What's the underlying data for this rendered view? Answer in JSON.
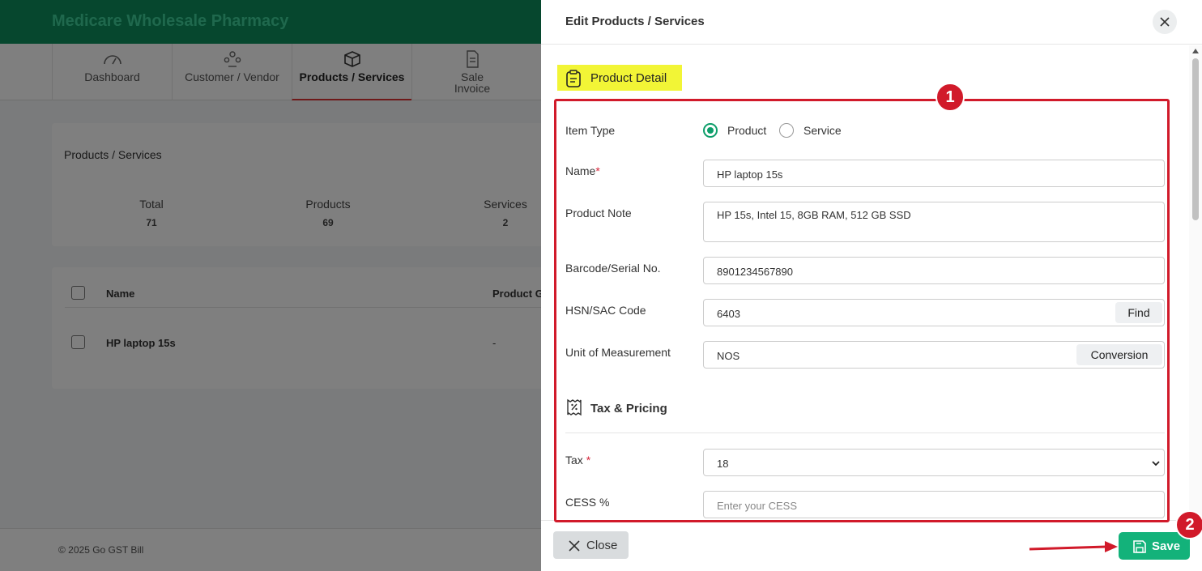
{
  "app": {
    "brand": "Medicare Wholesale Pharmacy",
    "nav": [
      {
        "label": "Dashboard",
        "icon": "gauge-icon"
      },
      {
        "label": "Customer / Vendor",
        "icon": "users-icon"
      },
      {
        "label": "Products / Services",
        "icon": "box-icon",
        "active": true
      },
      {
        "label": "Sale Invoice",
        "icon": "invoice-icon"
      }
    ],
    "summary": {
      "title": "Products / Services",
      "stats": [
        {
          "label": "Total",
          "value": "71"
        },
        {
          "label": "Products",
          "value": "69"
        },
        {
          "label": "Services",
          "value": "2"
        }
      ]
    },
    "table": {
      "headers": [
        "Name",
        "Product G"
      ],
      "rows": [
        {
          "name": "HP laptop 15s",
          "group": "-"
        }
      ]
    },
    "footer": "© 2025 Go GST Bill"
  },
  "drawer": {
    "title": "Edit Products / Services",
    "section_title": "Product Detail",
    "fields": {
      "item_type": {
        "label": "Item Type",
        "options": [
          "Product",
          "Service"
        ],
        "selected": "Product"
      },
      "name": {
        "label": "Name",
        "value": "HP laptop 15s"
      },
      "product_note": {
        "label": "Product Note",
        "value": "HP 15s, Intel 15, 8GB RAM, 512 GB SSD"
      },
      "barcode": {
        "label": "Barcode/Serial No.",
        "value": "8901234567890"
      },
      "hsn": {
        "label": "HSN/SAC Code",
        "value": "6403",
        "button": "Find"
      },
      "uom": {
        "label": "Unit of Measurement",
        "value": "NOS",
        "button": "Conversion"
      },
      "tax": {
        "label": "Tax ",
        "value": "18"
      },
      "cess": {
        "label": "CESS %",
        "placeholder": "Enter your CESS"
      }
    },
    "required_mark": "*",
    "tax_section_title": "Tax & Pricing",
    "close_label": "Close",
    "save_label": "Save"
  },
  "annotations": {
    "badge1": "1",
    "badge2": "2",
    "color": "#d11a2a"
  },
  "colors": {
    "primary": "#13b27a",
    "header": "#0d8f5c",
    "highlight": "#f2f536"
  }
}
